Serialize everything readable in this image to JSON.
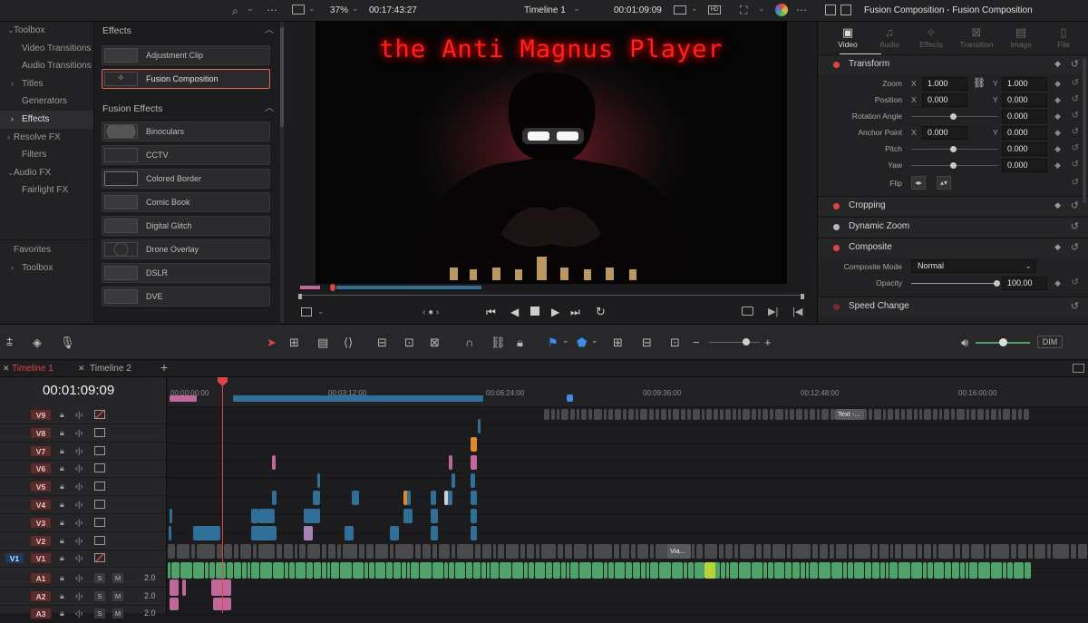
{
  "topbar": {
    "zoom": "37%",
    "source_timecode": "00:17:43:27",
    "timeline_name": "Timeline 1",
    "record_timecode": "00:01:09:09",
    "inspector_title": "Fusion Composition - Fusion Composition"
  },
  "toolbox": {
    "items": [
      {
        "label": "Toolbox",
        "caret": "⌄"
      },
      {
        "label": "Video Transitions"
      },
      {
        "label": "Audio Transitions"
      },
      {
        "label": "Titles",
        "caret": "›"
      },
      {
        "label": "Generators"
      },
      {
        "label": "Effects",
        "caret": "›"
      },
      {
        "label": "Resolve FX",
        "caret": "›"
      },
      {
        "label": "Filters"
      },
      {
        "label": "Audio FX",
        "caret": "⌄"
      },
      {
        "label": "Fairlight FX"
      }
    ],
    "favorites": "Favorites",
    "favorites_toolbox": "Toolbox"
  },
  "effects_list": {
    "section1": "Effects",
    "items1": [
      "Adjustment Clip",
      "Fusion Composition"
    ],
    "section2": "Fusion Effects",
    "items2": [
      "Binoculars",
      "CCTV",
      "Colored Border",
      "Comic Book",
      "Digital Glitch",
      "Drone Overlay",
      "DSLR",
      "DVE"
    ]
  },
  "viewer": {
    "overlay_title": "the Anti Magnus Player"
  },
  "inspector": {
    "tabs": [
      "Video",
      "Audio",
      "Effects",
      "Transition",
      "Image",
      "File"
    ],
    "transform": {
      "title": "Transform",
      "zoom_label": "Zoom",
      "zoom_x": "1.000",
      "zoom_y": "1.000",
      "position_label": "Position",
      "position_x": "0.000",
      "position_y": "0.000",
      "rotation_label": "Rotation Angle",
      "rotation": "0.000",
      "anchor_label": "Anchor Point",
      "anchor_x": "0.000",
      "anchor_y": "0.000",
      "pitch_label": "Pitch",
      "pitch": "0.000",
      "yaw_label": "Yaw",
      "yaw": "0.000",
      "flip_label": "Flip",
      "x_label": "X",
      "y_label": "Y"
    },
    "cropping": "Cropping",
    "dynamic_zoom": "Dynamic Zoom",
    "composite": {
      "title": "Composite",
      "mode_label": "Composite Mode",
      "mode": "Normal",
      "opacity_label": "Opacity",
      "opacity": "100.00"
    },
    "speed_change": "Speed Change"
  },
  "toolbar": {
    "dim": "DIM"
  },
  "timeline_tabs": [
    "Timeline 1",
    "Timeline 2"
  ],
  "timeline": {
    "timecode": "00:01:09:09",
    "ruler": [
      "00:00:00:00",
      "00:03:12:00",
      "00:06:24:00",
      "00:09:36:00",
      "00:12:48:00",
      "00:16:00:00"
    ],
    "video_tracks": [
      "V9",
      "V8",
      "V7",
      "V6",
      "V5",
      "V4",
      "V3",
      "V2",
      "V1"
    ],
    "source_track": "V1",
    "audio_tracks": [
      {
        "name": "A1",
        "level": "2.0"
      },
      {
        "name": "A2",
        "level": "2.0"
      },
      {
        "name": "A3",
        "level": "2.0"
      }
    ],
    "solo": "S",
    "mute": "M",
    "clip_text": "Text -...",
    "clip_via": "Via..."
  },
  "colors": {
    "accent_red": "#e04545",
    "clip_blue": "#2f6f98",
    "clip_pink": "#c0689a",
    "clip_orange": "#e08a2a",
    "clip_gray": "#4a4a4d",
    "audio_green": "#4fa368",
    "title_red": "#ff2222"
  }
}
